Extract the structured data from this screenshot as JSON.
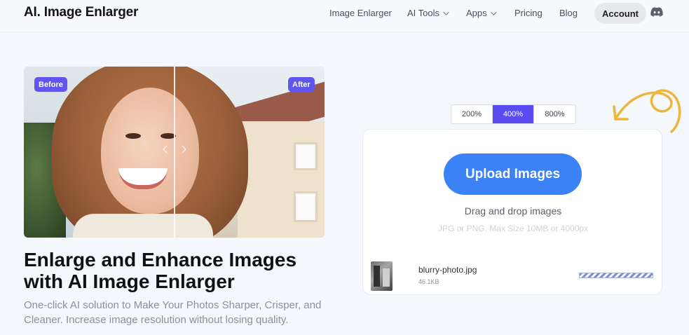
{
  "nav": {
    "logo": "AI. Image Enlarger",
    "items": [
      {
        "label": "Image Enlarger",
        "dropdown": false
      },
      {
        "label": "AI Tools",
        "dropdown": true
      },
      {
        "label": "Apps",
        "dropdown": true
      },
      {
        "label": "Pricing",
        "dropdown": false
      },
      {
        "label": "Blog",
        "dropdown": false
      }
    ],
    "account": "Account",
    "discord_icon": "discord-icon"
  },
  "hero": {
    "before_tag": "Before",
    "after_tag": "After",
    "headline": "Enlarge and Enhance Images with AI Image Enlarger",
    "subline": "One-click AI solution to Make Your Photos Sharper, Crisper, and Cleaner. Increase image resolution without losing quality."
  },
  "scale": {
    "options": [
      "200%",
      "400%",
      "800%"
    ],
    "selected": "400%"
  },
  "upload": {
    "button": "Upload Images",
    "drag_text": "Drag and drop images",
    "hint": "JPG or PNG. Max Size 10MB or 4000px",
    "file": {
      "name": "blurry-photo.jpg",
      "size": "46.1KB"
    }
  },
  "colors": {
    "accent": "#5a4cf0",
    "upload_button": "#3b82f6",
    "tag": "#6155ef",
    "doodle": "#efb43a"
  }
}
